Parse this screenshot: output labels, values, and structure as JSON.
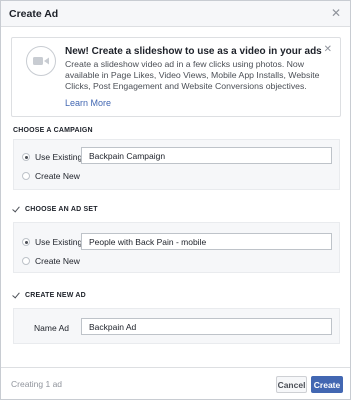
{
  "dialog": {
    "title": "Create Ad",
    "close_glyph": "✕"
  },
  "promo": {
    "icon": "video-camera-icon",
    "title": "New! Create a slideshow to use as a video in your ads",
    "body": "Create a slideshow video ad in a few clicks using photos. Now available in Page Likes, Video Views, Mobile App Installs, Website Clicks, Post Engagement and Website Conversions objectives.",
    "link": "Learn More",
    "close_glyph": "✕"
  },
  "campaign": {
    "section_label": "CHOOSE A CAMPAIGN",
    "options": [
      "Use Existing",
      "Create New"
    ],
    "selected": "Use Existing",
    "value": "Backpain Campaign"
  },
  "ad_set": {
    "section_label": "CHOOSE AN AD SET",
    "checked": true,
    "options": [
      "Use Existing",
      "Create New"
    ],
    "selected": "Use Existing",
    "value": "People with Back Pain - mobile"
  },
  "new_ad": {
    "section_label": "CREATE NEW AD",
    "checked": true,
    "name_label": "Name Ad",
    "name_value": "Backpain Ad"
  },
  "footer": {
    "status": "Creating 1 ad",
    "cancel_label": "Cancel",
    "create_label": "Create"
  },
  "colors": {
    "accent": "#4267b2",
    "panel_bg": "#f6f7f9",
    "border": "#dddfe2"
  }
}
